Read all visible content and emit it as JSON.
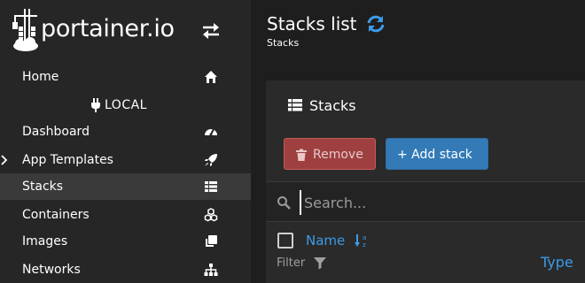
{
  "brand": {
    "logo_text": "portainer.io",
    "logo_icon": "portainer-crane-logo",
    "toggle_icon": "exchange-arrows-icon"
  },
  "sidebar": {
    "home": {
      "label": "Home",
      "icon": "home-icon"
    },
    "endpoint": {
      "label": "LOCAL",
      "icon": "plug-icon"
    },
    "items": [
      {
        "label": "Dashboard",
        "icon": "tachometer-icon",
        "active": false
      },
      {
        "label": "App Templates",
        "icon": "rocket-icon",
        "active": false,
        "has_chevron": true
      },
      {
        "label": "Stacks",
        "icon": "th-list-icon",
        "active": true
      },
      {
        "label": "Containers",
        "icon": "cubes-icon",
        "active": false
      },
      {
        "label": "Images",
        "icon": "clone-icon",
        "active": false
      },
      {
        "label": "Networks",
        "icon": "sitemap-icon",
        "active": false
      }
    ]
  },
  "header": {
    "title": "Stacks list",
    "refresh_icon": "refresh-icon",
    "breadcrumb": "Stacks"
  },
  "panel": {
    "title": "Stacks",
    "title_icon": "th-list-icon",
    "remove_label": "Remove",
    "add_label": "+ Add stack",
    "search_placeholder": "Search...",
    "columns": {
      "name": "Name",
      "type": "Type",
      "filter_label": "Filter"
    }
  },
  "colors": {
    "sidebar_bg": "#262626",
    "active_item_bg": "#3a3a3a",
    "accent_blue": "#3d9be9",
    "remove_btn": "#9e4040",
    "add_btn": "#337ab7"
  }
}
